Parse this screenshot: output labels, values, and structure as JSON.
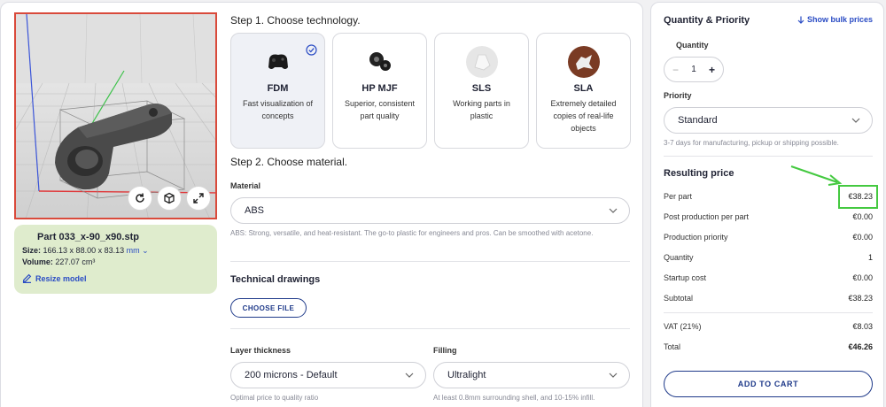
{
  "model": {
    "name": "Part 033_x-90_x90.stp",
    "size_label": "Size:",
    "size_value": "166.13 x 88.00 x 83.13",
    "size_unit": "mm",
    "volume_label": "Volume:",
    "volume_value": "227.07 cm³",
    "resize_label": "Resize model"
  },
  "step1": {
    "title": "Step 1. Choose technology.",
    "technologies": [
      {
        "name": "FDM",
        "desc": "Fast visualization of concepts",
        "selected": true
      },
      {
        "name": "HP MJF",
        "desc": "Superior, consistent part quality",
        "selected": false
      },
      {
        "name": "SLS",
        "desc": "Working parts in plastic",
        "selected": false
      },
      {
        "name": "SLA",
        "desc": "Extremely detailed copies of real-life objects",
        "selected": false
      }
    ]
  },
  "step2": {
    "title": "Step 2. Choose material.",
    "material_label": "Material",
    "material_value": "ABS",
    "material_hint": "ABS: Strong, versatile, and heat-resistant. The go-to plastic for engineers and pros. Can be smoothed with acetone.",
    "drawings_title": "Technical drawings",
    "choose_file_label": "CHOOSE FILE",
    "layer_label": "Layer thickness",
    "layer_value": "200 microns - Default",
    "layer_hint": "Optimal price to quality ratio",
    "filling_label": "Filling",
    "filling_value": "Ultralight",
    "filling_hint": "At least 0.8mm surrounding shell, and 10-15% infill."
  },
  "order": {
    "title": "Quantity & Priority",
    "bulk_link": "Show bulk prices",
    "quantity_label": "Quantity",
    "quantity_value": "1",
    "priority_label": "Priority",
    "priority_value": "Standard",
    "priority_hint": "3-7 days for manufacturing, pickup or shipping possible.",
    "price_title": "Resulting price",
    "rows": [
      {
        "label": "Per part",
        "value": "€38.23"
      },
      {
        "label": "Post production per part",
        "value": "€0.00"
      },
      {
        "label": "Production priority",
        "value": "€0.00"
      },
      {
        "label": "Quantity",
        "value": "1"
      },
      {
        "label": "Startup cost",
        "value": "€0.00"
      },
      {
        "label": "Subtotal",
        "value": "€38.23"
      }
    ],
    "vat_label": "VAT (21%)",
    "vat_value": "€8.03",
    "total_label": "Total",
    "total_value": "€46.26",
    "add_to_cart": "ADD TO CART"
  },
  "colors": {
    "accent": "#1f3a8a",
    "link": "#2a4cc4",
    "highlight": "#44c940",
    "viewer_border": "#d94a3b",
    "info_bg": "#dfeccd"
  }
}
